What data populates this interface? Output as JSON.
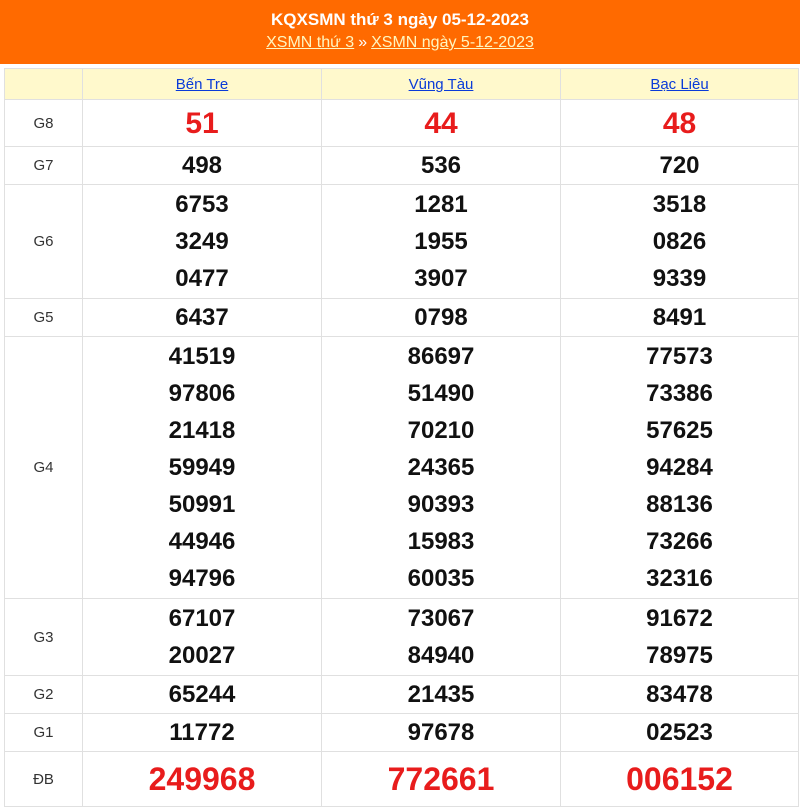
{
  "header": {
    "title": "KQXSMN thứ 3 ngày 05-12-2023",
    "link_day": "XSMN thứ 3",
    "separator": "»",
    "link_date": "XSMN ngày 5-12-2023"
  },
  "colors": {
    "header_bg": "#ff6a00",
    "column_header_bg": "#fff9cc",
    "highlight": "#e81c1c",
    "link": "#0a3bd8"
  },
  "columns": [
    "Bến Tre",
    "Vũng Tàu",
    "Bạc Liêu"
  ],
  "prizes": [
    {
      "label": "G8",
      "values": [
        [
          "51"
        ],
        [
          "44"
        ],
        [
          "48"
        ]
      ]
    },
    {
      "label": "G7",
      "values": [
        [
          "498"
        ],
        [
          "536"
        ],
        [
          "720"
        ]
      ]
    },
    {
      "label": "G6",
      "values": [
        [
          "6753",
          "3249",
          "0477"
        ],
        [
          "1281",
          "1955",
          "3907"
        ],
        [
          "3518",
          "0826",
          "9339"
        ]
      ]
    },
    {
      "label": "G5",
      "values": [
        [
          "6437"
        ],
        [
          "0798"
        ],
        [
          "8491"
        ]
      ]
    },
    {
      "label": "G4",
      "values": [
        [
          "41519",
          "97806",
          "21418",
          "59949",
          "50991",
          "44946",
          "94796"
        ],
        [
          "86697",
          "51490",
          "70210",
          "24365",
          "90393",
          "15983",
          "60035"
        ],
        [
          "77573",
          "73386",
          "57625",
          "94284",
          "88136",
          "73266",
          "32316"
        ]
      ]
    },
    {
      "label": "G3",
      "values": [
        [
          "67107",
          "20027"
        ],
        [
          "73067",
          "84940"
        ],
        [
          "91672",
          "78975"
        ]
      ]
    },
    {
      "label": "G2",
      "values": [
        [
          "65244"
        ],
        [
          "21435"
        ],
        [
          "83478"
        ]
      ]
    },
    {
      "label": "G1",
      "values": [
        [
          "11772"
        ],
        [
          "97678"
        ],
        [
          "02523"
        ]
      ]
    },
    {
      "label": "ĐB",
      "values": [
        [
          "249968"
        ],
        [
          "772661"
        ],
        [
          "006152"
        ]
      ]
    }
  ]
}
